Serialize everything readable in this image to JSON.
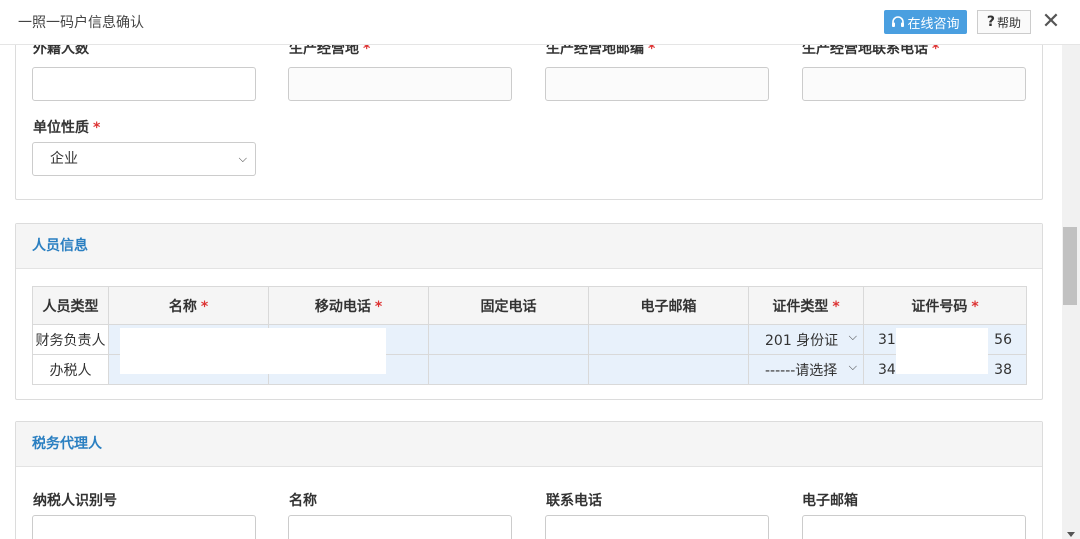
{
  "dialog": {
    "title": "一照一码户信息确认",
    "consult_label": "在线咨询",
    "help_label": "帮助",
    "close_glyph": "✕"
  },
  "basic": {
    "foreign_count_label": "外籍人数",
    "prod_address_label": "生产经营地",
    "prod_postcode_label": "生产经营地邮编",
    "prod_phone_label": "生产经营地联系电话",
    "unit_type_label": "单位性质",
    "unit_type_value": "企业",
    "required_mark": "*"
  },
  "personnel": {
    "section_title": "人员信息",
    "columns": [
      "人员类型",
      "名称",
      "移动电话",
      "固定电话",
      "电子邮箱",
      "证件类型",
      "证件号码"
    ],
    "rows": [
      {
        "type": "财务负责人",
        "id_type": "201 身份证",
        "id_prefix": "31",
        "id_suffix": "56"
      },
      {
        "type": "办税人",
        "id_type": "------请选择",
        "id_prefix": "34",
        "id_suffix": "38"
      }
    ]
  },
  "agent": {
    "section_title": "税务代理人",
    "taxpayer_id_label": "纳税人识别号",
    "name_label": "名称",
    "phone_label": "联系电话",
    "email_label": "电子邮箱"
  },
  "icons": {
    "headset": "headset-icon",
    "chevron": "chevron-down-icon"
  },
  "colors": {
    "accent": "#2a7fc1",
    "consult_button": "#4a9fe0",
    "required": "#dd3333"
  }
}
